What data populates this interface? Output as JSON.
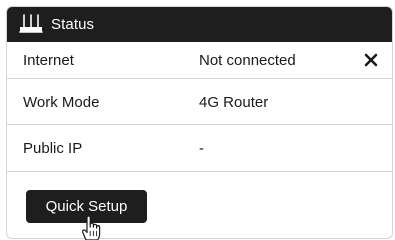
{
  "header": {
    "title": "Status",
    "icon": "router-icon"
  },
  "rows": [
    {
      "label": "Internet",
      "value": "Not connected",
      "action_icon": "close-icon"
    },
    {
      "label": "Work Mode",
      "value": "4G Router"
    },
    {
      "label": "Public IP",
      "value": "-"
    }
  ],
  "actions": {
    "quick_setup_label": "Quick Setup"
  },
  "cursor": "hand-pointer-icon",
  "colors": {
    "header_bg": "#1e1e1e",
    "button_bg": "#1e1e1e",
    "divider": "#d4d4d4",
    "text": "#1a1a1a"
  }
}
